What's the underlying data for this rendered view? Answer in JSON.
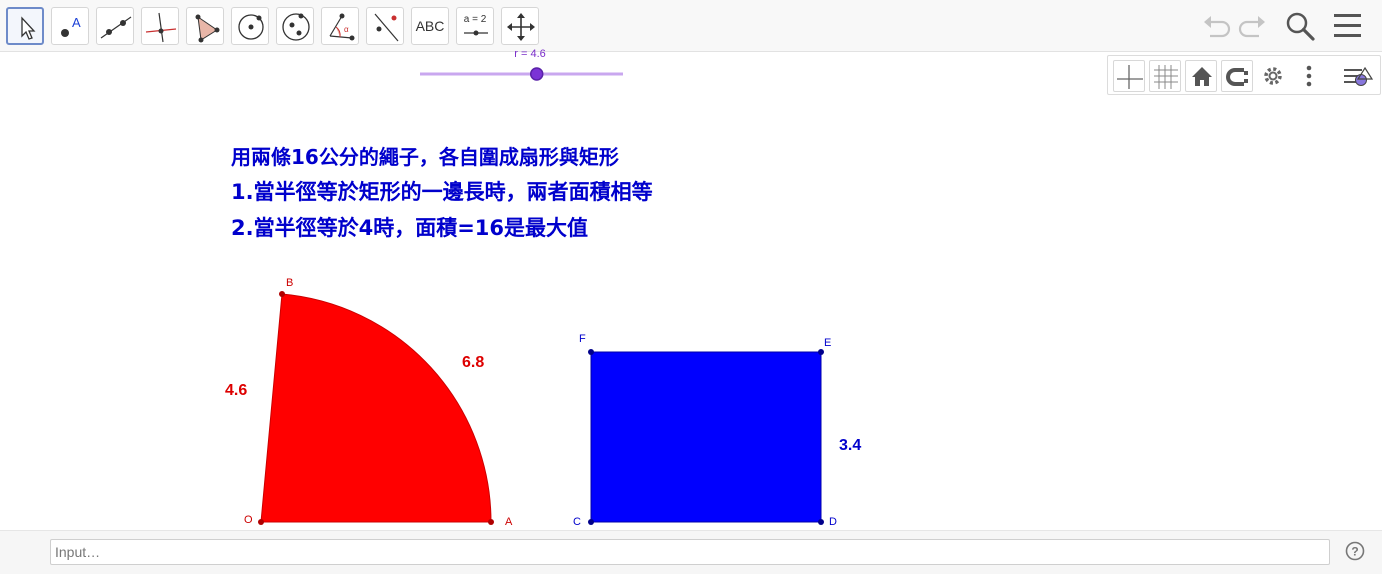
{
  "toolbar": {
    "tools": [
      {
        "id": "move",
        "icon": "pointer-arrow-icon"
      },
      {
        "id": "point",
        "icon": "point-icon",
        "text": "A"
      },
      {
        "id": "line",
        "icon": "line-through-two-points-icon"
      },
      {
        "id": "perpendicular",
        "icon": "perpendicular-line-icon"
      },
      {
        "id": "polygon",
        "icon": "polygon-icon"
      },
      {
        "id": "circle",
        "icon": "circle-with-center-icon"
      },
      {
        "id": "conic",
        "icon": "ellipse-icon"
      },
      {
        "id": "angle",
        "icon": "angle-icon",
        "text": "α"
      },
      {
        "id": "reflect",
        "icon": "reflect-about-line-icon"
      },
      {
        "id": "text",
        "label": "ABC"
      },
      {
        "id": "slider",
        "label": "a = 2"
      },
      {
        "id": "move-graphics",
        "icon": "move-graphics-view-icon"
      }
    ],
    "right_icons": [
      "undo-icon",
      "redo-icon",
      "search-icon",
      "menu-icon"
    ]
  },
  "graphics_panel": {
    "icons": [
      "axes-icon",
      "grid-icon",
      "home-icon",
      "point-capturing-icon",
      "settings-icon",
      "more-icon",
      "style-bar-toggle-icon"
    ]
  },
  "slider": {
    "label": "r = 4.6",
    "value": 4.6,
    "min": 0,
    "max": 8
  },
  "text": {
    "line1": "用兩條16公分的繩子，各自圍成扇形與矩形",
    "line2": "1.當半徑等於矩形的一邊長時，兩者面積相等",
    "line3": "2.當半徑等於4時，面積=16是最大值"
  },
  "sector": {
    "points": {
      "O": "O",
      "A": "A",
      "B": "B"
    },
    "radius_label": "4.6",
    "arc_label": "6.8",
    "color": "#ff0000"
  },
  "rectangle": {
    "points": {
      "C": "C",
      "D": "D",
      "E": "E",
      "F": "F"
    },
    "side_label": "3.4",
    "color": "#0000ff"
  },
  "input_bar": {
    "placeholder": "Input…"
  }
}
